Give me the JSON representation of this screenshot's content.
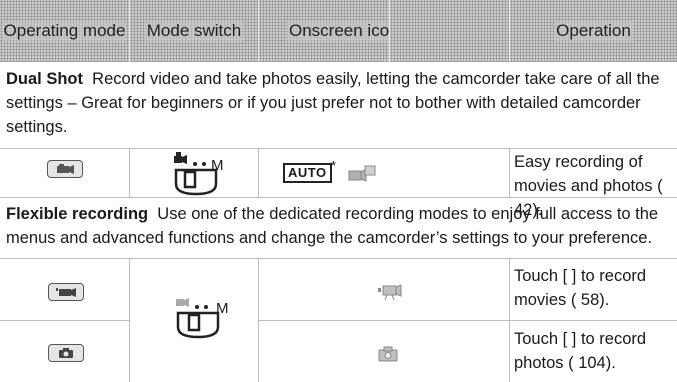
{
  "table": {
    "headers": {
      "operating_mode": "Operating mode",
      "mode_switch": "Mode switch",
      "onscreen_icon": "Onscreen icon",
      "operation": "Operation"
    },
    "dual_shot": {
      "title": "Dual Shot",
      "description": "Record video and take photos easily, letting the camcorder take care of all the settings – Great for beginners or if you just prefer not to bother with detailed camcorder settings.",
      "switch_label": "M",
      "icon_text": "AUTO",
      "icon_asterisk": "*",
      "operation": "Easy recording of movies and photos (  42)."
    },
    "flexible": {
      "title": "Flexible recording",
      "description": "Use one of the dedicated recording modes to enjoy full access to the menus and advanced functions and change the camcorder’s settings to your preference.",
      "switch_label": "M",
      "movie_operation": "Touch [ ] to record movies ( 58).",
      "photo_operation": "Touch [ ] to record photos ( 104)."
    }
  },
  "icons": {
    "dual_mode": "dual-shot-camera-icon",
    "movie_mode": "movie-camera-icon",
    "photo_mode": "photo-camera-icon",
    "book_ref": "book-reference-icon",
    "mode_switch": "mode-switch-icon"
  },
  "colors": {
    "header_bg": "#c9c9c9",
    "grid_line": "#bdbdbd",
    "icon_fill": "#b0b0b0"
  }
}
